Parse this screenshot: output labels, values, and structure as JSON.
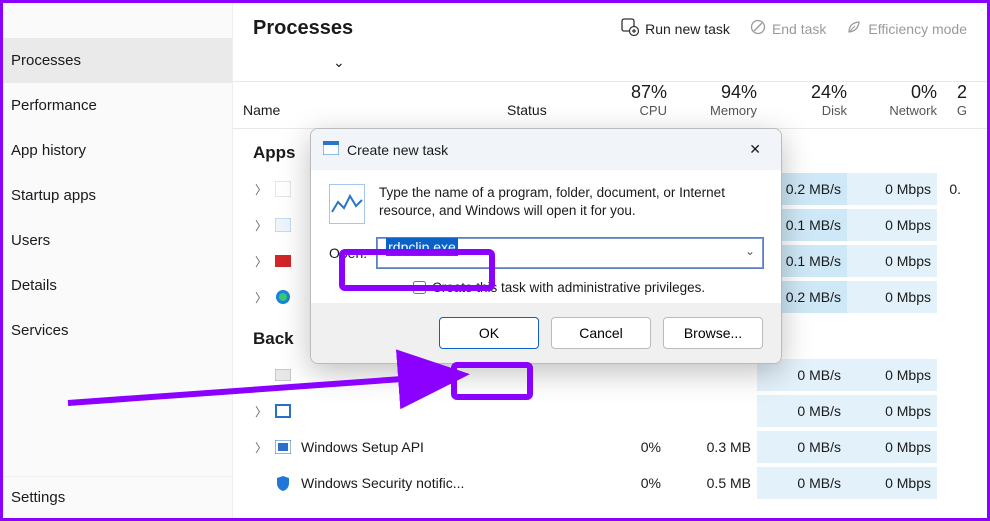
{
  "sidebar": {
    "items": [
      {
        "label": "Processes",
        "active": true
      },
      {
        "label": "Performance"
      },
      {
        "label": "App history"
      },
      {
        "label": "Startup apps"
      },
      {
        "label": "Users"
      },
      {
        "label": "Details"
      },
      {
        "label": "Services"
      }
    ],
    "bottom": "Settings"
  },
  "header": {
    "title": "Processes",
    "run_new_task": "Run new task",
    "end_task": "End task",
    "efficiency_mode": "Efficiency mode"
  },
  "columns": {
    "name": "Name",
    "status": "Status",
    "stats": [
      {
        "pct": "87%",
        "label": "CPU"
      },
      {
        "pct": "94%",
        "label": "Memory"
      },
      {
        "pct": "24%",
        "label": "Disk"
      },
      {
        "pct": "0%",
        "label": "Network"
      },
      {
        "pct": "2",
        "label": "G"
      }
    ]
  },
  "groups": {
    "apps_title": "Apps",
    "bg_title": "Back"
  },
  "rows": [
    {
      "name": "",
      "cpu": "",
      "mem": "",
      "disk": "0.2 MB/s",
      "net": "0 Mbps",
      "gpu": "0."
    },
    {
      "name": "",
      "cpu": "",
      "mem": "",
      "disk": "0.1 MB/s",
      "net": "0 Mbps",
      "gpu": ""
    },
    {
      "name": "",
      "cpu": "",
      "mem": "",
      "disk": "0.1 MB/s",
      "net": "0 Mbps",
      "gpu": ""
    },
    {
      "name": "",
      "cpu": "",
      "mem": "",
      "disk": "0.2 MB/s",
      "net": "0 Mbps",
      "gpu": ""
    },
    {
      "name": "",
      "cpu": "",
      "mem": "",
      "disk": "0 MB/s",
      "net": "0 Mbps",
      "gpu": ""
    },
    {
      "name": "",
      "cpu": "",
      "mem": "",
      "disk": "0 MB/s",
      "net": "0 Mbps",
      "gpu": ""
    },
    {
      "name": "Windows Setup API",
      "cpu": "0%",
      "mem": "0.3 MB",
      "disk": "0 MB/s",
      "net": "0 Mbps",
      "gpu": ""
    },
    {
      "name": "Windows Security notific...",
      "cpu": "0%",
      "mem": "0.5 MB",
      "disk": "0 MB/s",
      "net": "0 Mbps",
      "gpu": ""
    }
  ],
  "dialog": {
    "title": "Create new task",
    "description": "Type the name of a program, folder, document, or Internet resource, and Windows will open it for you.",
    "open_label": "Open:",
    "input_value": "rdpclip.exe",
    "admin_checkbox": "Create this task with administrative privileges.",
    "ok": "OK",
    "cancel": "Cancel",
    "browse": "Browse..."
  }
}
